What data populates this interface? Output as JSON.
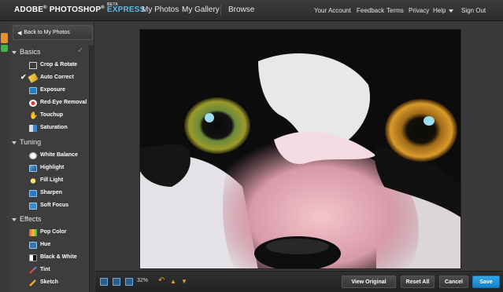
{
  "header": {
    "brand_main": "ADOBE",
    "brand_product": "PHOTOSHOP",
    "brand_express": "EXPRESS",
    "brand_beta": "BETA",
    "nav": [
      "My Photos",
      "My Gallery",
      "Browse"
    ],
    "right_links": [
      "Your Account",
      "Feedback",
      "Terms",
      "Privacy",
      "Help",
      "Sign Out"
    ]
  },
  "sidebar": {
    "back_label": "Back to My Photos",
    "sections": [
      {
        "title": "Basics",
        "items": [
          {
            "label": "Crop & Rotate",
            "icon": "crop-icon",
            "checked": false
          },
          {
            "label": "Auto Correct",
            "icon": "auto-correct-icon",
            "checked": true
          },
          {
            "label": "Exposure",
            "icon": "exposure-icon",
            "checked": false
          },
          {
            "label": "Red-Eye Removal",
            "icon": "red-eye-icon",
            "checked": false
          },
          {
            "label": "Touchup",
            "icon": "touchup-hand-icon",
            "checked": false
          },
          {
            "label": "Saturation",
            "icon": "saturation-icon",
            "checked": false
          }
        ]
      },
      {
        "title": "Tuning",
        "items": [
          {
            "label": "White Balance",
            "icon": "white-balance-icon",
            "checked": false
          },
          {
            "label": "Highlight",
            "icon": "highlight-icon",
            "checked": false
          },
          {
            "label": "Fill Light",
            "icon": "fill-light-icon",
            "checked": false
          },
          {
            "label": "Sharpen",
            "icon": "sharpen-icon",
            "checked": false
          },
          {
            "label": "Soft Focus",
            "icon": "soft-focus-icon",
            "checked": false
          }
        ]
      },
      {
        "title": "Effects",
        "items": [
          {
            "label": "Pop Color",
            "icon": "pop-color-icon",
            "checked": false
          },
          {
            "label": "Hue",
            "icon": "hue-icon",
            "checked": false
          },
          {
            "label": "Black & White",
            "icon": "black-white-icon",
            "checked": false
          },
          {
            "label": "Tint",
            "icon": "tint-icon",
            "checked": false
          },
          {
            "label": "Sketch",
            "icon": "sketch-icon",
            "checked": false
          }
        ]
      }
    ]
  },
  "toolbar": {
    "zoom": "32%",
    "view_original": "View Original",
    "reset_all": "Reset All",
    "cancel": "Cancel",
    "save": "Save"
  },
  "colors": {
    "accent": "#1a8fd6",
    "express": "#5fb6e6",
    "background": "#3a3a3a"
  }
}
